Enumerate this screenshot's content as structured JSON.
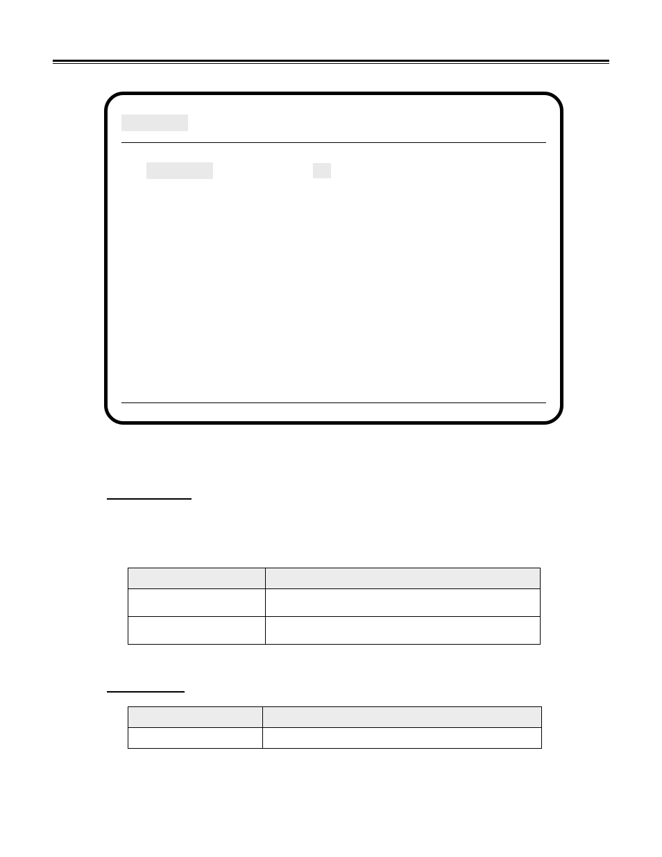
{
  "rules": {
    "top": ""
  },
  "capsule": {
    "header_label": "",
    "row2_label_a": "",
    "row2_label_b": ""
  },
  "section1": {
    "underline_label": "",
    "table": {
      "headers": [
        "",
        ""
      ],
      "rows": [
        [
          "",
          ""
        ],
        [
          "",
          ""
        ]
      ]
    }
  },
  "section2": {
    "underline_label": "",
    "table": {
      "headers": [
        "",
        ""
      ],
      "rows": [
        [
          "",
          ""
        ]
      ]
    }
  }
}
